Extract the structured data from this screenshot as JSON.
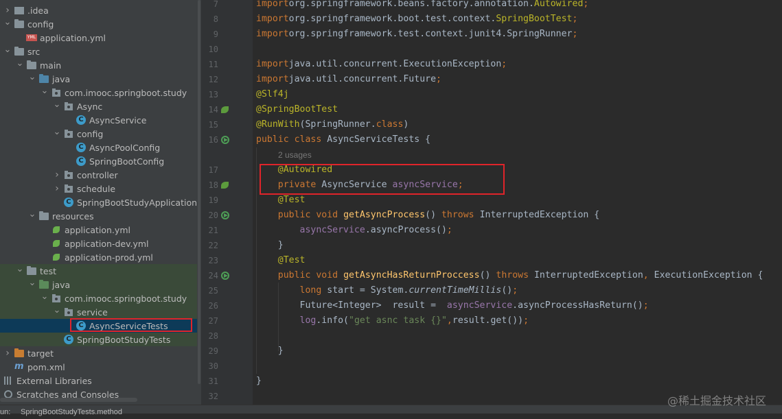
{
  "project_tree": {
    "items": [
      {
        "label": ".idea",
        "indent": 0,
        "expanded": false,
        "icon": "folder-icon",
        "kind": "idea"
      },
      {
        "label": "config",
        "indent": 0,
        "expanded": true,
        "icon": "folder-icon",
        "kind": "folder"
      },
      {
        "label": "application.yml",
        "indent": 1,
        "expanded": null,
        "icon": "yml-icon",
        "kind": "yml"
      },
      {
        "label": "src",
        "indent": 0,
        "expanded": true,
        "icon": "folder-icon",
        "kind": "folder"
      },
      {
        "label": "main",
        "indent": 1,
        "expanded": true,
        "icon": "folder-icon",
        "kind": "folder"
      },
      {
        "label": "java",
        "indent": 2,
        "expanded": true,
        "icon": "source-folder-icon",
        "kind": "src"
      },
      {
        "label": "com.imooc.springboot.study",
        "indent": 3,
        "expanded": true,
        "icon": "package-icon",
        "kind": "pkg"
      },
      {
        "label": "Async",
        "indent": 4,
        "expanded": true,
        "icon": "package-icon",
        "kind": "pkg"
      },
      {
        "label": "AsyncService",
        "indent": 5,
        "expanded": null,
        "icon": "class-icon",
        "kind": "class"
      },
      {
        "label": "config",
        "indent": 4,
        "expanded": true,
        "icon": "package-icon",
        "kind": "pkg"
      },
      {
        "label": "AsyncPoolConfig",
        "indent": 5,
        "expanded": null,
        "icon": "class-icon",
        "kind": "class"
      },
      {
        "label": "SpringBootConfig",
        "indent": 5,
        "expanded": null,
        "icon": "class-icon",
        "kind": "class"
      },
      {
        "label": "controller",
        "indent": 4,
        "expanded": false,
        "icon": "package-icon",
        "kind": "pkg"
      },
      {
        "label": "schedule",
        "indent": 4,
        "expanded": false,
        "icon": "package-icon",
        "kind": "pkg"
      },
      {
        "label": "SpringBootStudyApplication",
        "indent": 4,
        "expanded": null,
        "icon": "spring-class-icon",
        "kind": "class"
      },
      {
        "label": "resources",
        "indent": 2,
        "expanded": true,
        "icon": "resources-folder-icon",
        "kind": "res"
      },
      {
        "label": "application.yml",
        "indent": 3,
        "expanded": null,
        "icon": "spring-yml-icon",
        "kind": "spring"
      },
      {
        "label": "application-dev.yml",
        "indent": 3,
        "expanded": null,
        "icon": "spring-yml-icon",
        "kind": "spring"
      },
      {
        "label": "application-prod.yml",
        "indent": 3,
        "expanded": null,
        "icon": "spring-yml-icon",
        "kind": "spring"
      },
      {
        "label": "test",
        "indent": 1,
        "expanded": true,
        "icon": "folder-icon",
        "kind": "folder"
      },
      {
        "label": "java",
        "indent": 2,
        "expanded": true,
        "icon": "test-folder-icon",
        "kind": "test"
      },
      {
        "label": "com.imooc.springboot.study",
        "indent": 3,
        "expanded": true,
        "icon": "package-icon",
        "kind": "pkg"
      },
      {
        "label": "service",
        "indent": 4,
        "expanded": true,
        "icon": "package-icon",
        "kind": "pkg"
      },
      {
        "label": "AsyncServiceTests",
        "indent": 5,
        "expanded": null,
        "icon": "class-icon",
        "kind": "class"
      },
      {
        "label": "SpringBootStudyTests",
        "indent": 4,
        "expanded": null,
        "icon": "spring-class-icon",
        "kind": "class"
      },
      {
        "label": "target",
        "indent": 0,
        "expanded": false,
        "icon": "folder-icon",
        "kind": "target"
      },
      {
        "label": "pom.xml",
        "indent": 0,
        "expanded": null,
        "icon": "maven-icon",
        "kind": "m"
      },
      {
        "label": "External Libraries",
        "indent": -1,
        "expanded": null,
        "icon": "library-icon",
        "kind": "lib"
      },
      {
        "label": "Scratches and Consoles",
        "indent": -1,
        "expanded": null,
        "icon": "scratch-icon",
        "kind": "scratch"
      }
    ],
    "selected_label": "AsyncServiceTests"
  },
  "editor": {
    "usage_hint": "2 usages",
    "lines": [
      {
        "num": "7",
        "tokens": [
          [
            "kw",
            "import"
          ],
          [
            "",
            "org.springframework.beans.factory.annotation."
          ],
          [
            "an",
            "Autowired"
          ],
          [
            "kw",
            ";"
          ]
        ]
      },
      {
        "num": "8",
        "tokens": [
          [
            "kw",
            "import"
          ],
          [
            "",
            "org.springframework.boot.test.context."
          ],
          [
            "an",
            "SpringBootTest"
          ],
          [
            "kw",
            ";"
          ]
        ]
      },
      {
        "num": "9",
        "tokens": [
          [
            "kw",
            "import"
          ],
          [
            "",
            "org.springframework.test.context.junit4.SpringRunner"
          ],
          [
            "kw",
            ";"
          ]
        ]
      },
      {
        "num": "10",
        "tokens": []
      },
      {
        "num": "11",
        "tokens": [
          [
            "kw",
            "import"
          ],
          [
            "",
            "java.util.concurrent.ExecutionException"
          ],
          [
            "kw",
            ";"
          ]
        ]
      },
      {
        "num": "12",
        "tokens": [
          [
            "kw",
            "import"
          ],
          [
            "",
            "java.util.concurrent.Future"
          ],
          [
            "kw",
            ";"
          ]
        ]
      },
      {
        "num": "13",
        "tokens": [
          [
            "an",
            "@Slf4j"
          ]
        ]
      },
      {
        "num": "14",
        "tokens": [
          [
            "an",
            "@SpringBootTest"
          ]
        ]
      },
      {
        "num": "15",
        "tokens": [
          [
            "an",
            "@RunWith"
          ],
          [
            "",
            "(SpringRunner."
          ],
          [
            "kw",
            "class"
          ],
          [
            "",
            ")"
          ]
        ]
      },
      {
        "num": "16",
        "tokens": [
          [
            "kw",
            "public class"
          ],
          [
            "",
            " AsyncServiceTests {"
          ]
        ]
      },
      {
        "num": "17",
        "tokens": [
          [
            "",
            "    "
          ],
          [
            "an",
            "@Autowired"
          ]
        ]
      },
      {
        "num": "18",
        "tokens": [
          [
            "",
            "    "
          ],
          [
            "kw",
            "private"
          ],
          [
            "",
            " AsyncService "
          ],
          [
            "fld",
            "asyncService"
          ],
          [
            "kw",
            ";"
          ]
        ]
      },
      {
        "num": "19",
        "tokens": [
          [
            "",
            "    "
          ],
          [
            "an",
            "@Test"
          ]
        ]
      },
      {
        "num": "20",
        "tokens": [
          [
            "",
            "    "
          ],
          [
            "kw",
            "public void"
          ],
          [
            "",
            " "
          ],
          [
            "fn",
            "getAsyncProcess"
          ],
          [
            "",
            "() "
          ],
          [
            "kw",
            "throws"
          ],
          [
            "",
            " InterruptedException {"
          ]
        ]
      },
      {
        "num": "21",
        "tokens": [
          [
            "",
            "        "
          ],
          [
            "fld",
            "asyncService"
          ],
          [
            "",
            ".asyncProcess()"
          ],
          [
            "kw",
            ";"
          ]
        ]
      },
      {
        "num": "22",
        "tokens": [
          [
            "",
            "    }"
          ]
        ]
      },
      {
        "num": "23",
        "tokens": [
          [
            "",
            "    "
          ],
          [
            "an",
            "@Test"
          ]
        ]
      },
      {
        "num": "24",
        "tokens": [
          [
            "",
            "    "
          ],
          [
            "kw",
            "public void"
          ],
          [
            "",
            " "
          ],
          [
            "fn",
            "getAsyncHasReturnProccess"
          ],
          [
            "",
            "() "
          ],
          [
            "kw",
            "throws"
          ],
          [
            "",
            " InterruptedException"
          ],
          [
            "kw",
            ","
          ],
          [
            "",
            " ExecutionException {"
          ]
        ]
      },
      {
        "num": "25",
        "tokens": [
          [
            "",
            "        "
          ],
          [
            "kw",
            "long"
          ],
          [
            "",
            " "
          ],
          [
            "",
            "start = System."
          ],
          [
            "it",
            "currentTimeMillis"
          ],
          [
            "",
            "()"
          ],
          [
            "kw",
            ";"
          ]
        ]
      },
      {
        "num": "26",
        "tokens": [
          [
            "",
            "        Future<Integer>  result =  "
          ],
          [
            "fld",
            "asyncService"
          ],
          [
            "",
            ".asyncProcessHasReturn()"
          ],
          [
            "kw",
            ";"
          ]
        ]
      },
      {
        "num": "27",
        "tokens": [
          [
            "",
            "        "
          ],
          [
            "fld",
            "log"
          ],
          [
            "",
            ".info("
          ],
          [
            "str",
            "\"get asnc task {}\""
          ],
          [
            "kw",
            ","
          ],
          [
            "",
            "result.get())"
          ],
          [
            "kw",
            ";"
          ]
        ]
      },
      {
        "num": "28",
        "tokens": []
      },
      {
        "num": "29",
        "tokens": [
          [
            "",
            "    }"
          ]
        ]
      },
      {
        "num": "30",
        "tokens": []
      },
      {
        "num": "31",
        "tokens": [
          [
            "",
            "}"
          ]
        ]
      },
      {
        "num": "32",
        "tokens": []
      }
    ]
  },
  "status_bar": {
    "left_label": "un:",
    "run_config": "SpringBootStudyTests.method"
  },
  "watermark": "@稀土掘金技术社区",
  "colors": {
    "keyword": "#cc7832",
    "annotation": "#bbb529",
    "field": "#9876aa",
    "method": "#ffc66d",
    "string": "#6a8759",
    "highlight_box": "#e0242a"
  }
}
